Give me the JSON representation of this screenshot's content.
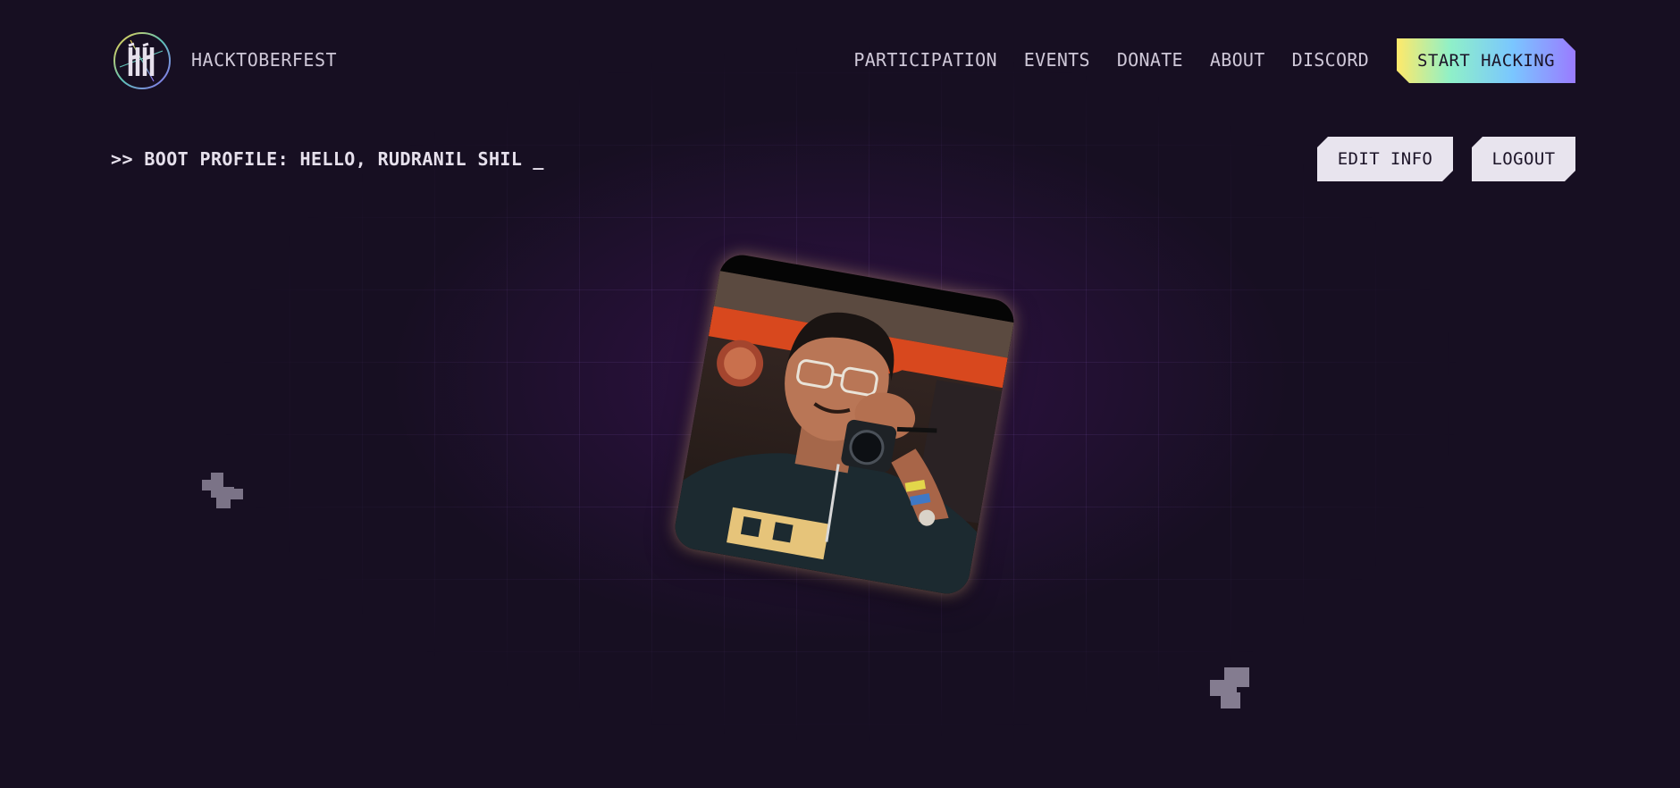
{
  "brand": {
    "name": "HACKTOBERFEST",
    "logo_icon": "hacktoberfest-logo-icon"
  },
  "nav": {
    "items": [
      {
        "label": "PARTICIPATION"
      },
      {
        "label": "EVENTS"
      },
      {
        "label": "DONATE"
      },
      {
        "label": "ABOUT"
      },
      {
        "label": "DISCORD"
      }
    ],
    "cta_label": "START HACKING"
  },
  "profile": {
    "boot_text": ">> BOOT PROFILE: HELLO, RUDRANIL SHIL",
    "cursor": "_",
    "edit_label": "EDIT INFO",
    "logout_label": "LOGOUT",
    "avatar_icon": "profile-photo"
  },
  "colors": {
    "background": "#170f22",
    "grid": "#3a2a55",
    "cta_gradient": [
      "#ffe96a",
      "#8ff0c8",
      "#7ac6ff",
      "#9a7bff"
    ],
    "button_light": "#e8e4ee"
  }
}
